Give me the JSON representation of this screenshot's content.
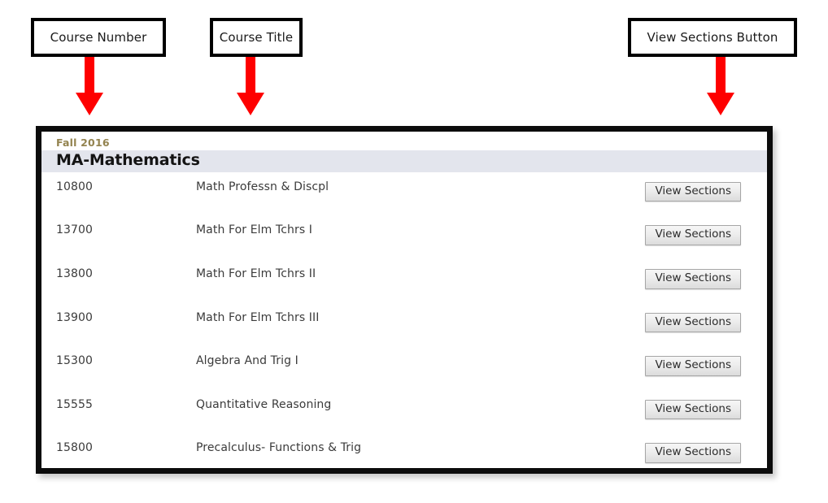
{
  "annotations": [
    {
      "id": "course-number",
      "label": "Course Number"
    },
    {
      "id": "course-title",
      "label": "Course Title"
    },
    {
      "id": "view-sections-button",
      "label": "View Sections Button"
    }
  ],
  "panel": {
    "term": "Fall 2016",
    "department": "MA-Mathematics",
    "button_label": "View Sections",
    "courses": [
      {
        "number": "10800",
        "title": "Math Professn & Discpl"
      },
      {
        "number": "13700",
        "title": "Math For Elm Tchrs I"
      },
      {
        "number": "13800",
        "title": "Math For Elm Tchrs II"
      },
      {
        "number": "13900",
        "title": "Math For Elm Tchrs III"
      },
      {
        "number": "15300",
        "title": "Algebra And Trig I"
      },
      {
        "number": "15555",
        "title": "Quantitative Reasoning"
      },
      {
        "number": "15800",
        "title": "Precalculus- Functions & Trig"
      }
    ]
  },
  "colors": {
    "arrow": "#fe0000",
    "term_text": "#93834f",
    "dept_band": "#e3e5ed",
    "panel_border": "#0c0c0c"
  }
}
